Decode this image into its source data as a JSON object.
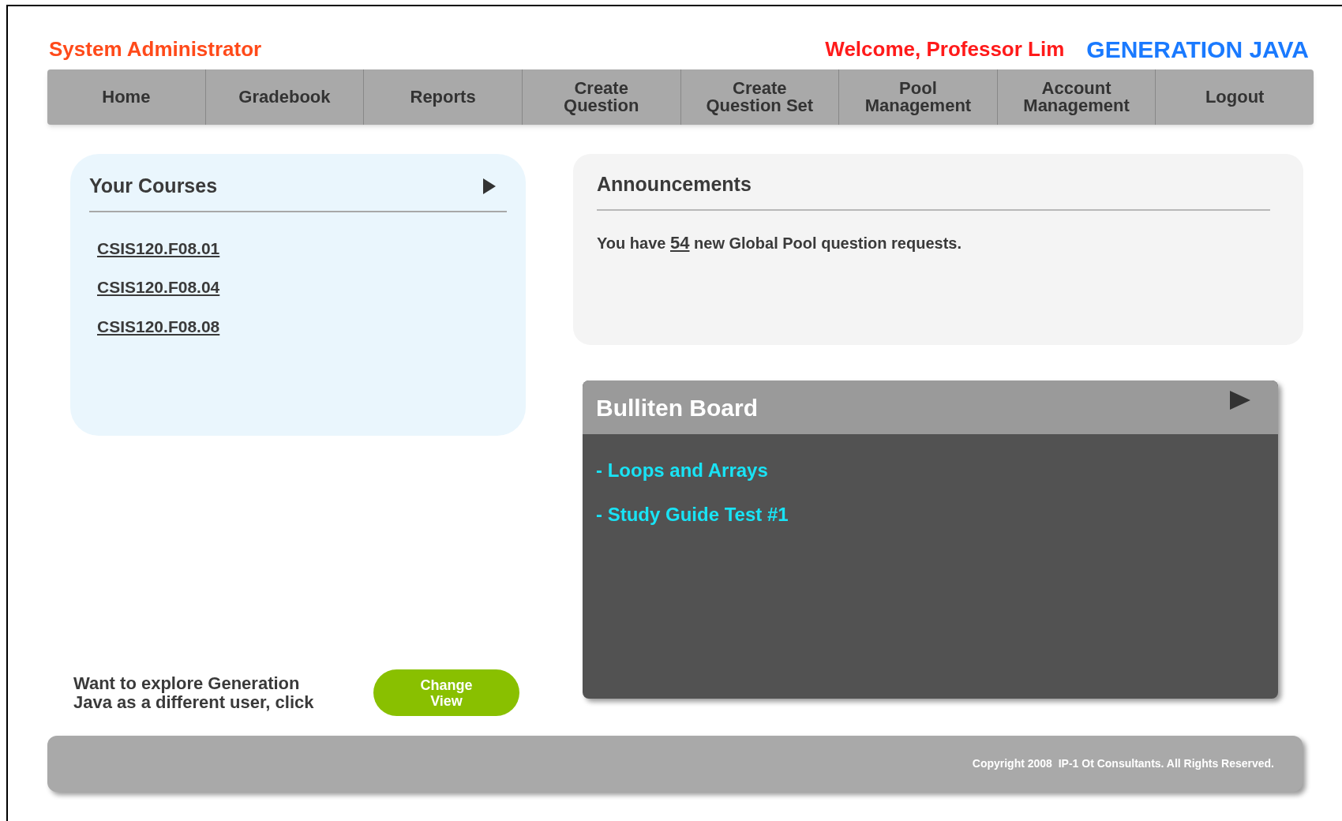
{
  "header": {
    "role": "System Administrator",
    "welcome": "Welcome, Professor Lim",
    "brand": "GENERATION JAVA"
  },
  "nav": [
    {
      "label": "Home"
    },
    {
      "label": "Gradebook"
    },
    {
      "label": "Reports"
    },
    {
      "label": "Create Question"
    },
    {
      "label": "Create Question Set"
    },
    {
      "label": "Pool Management"
    },
    {
      "label": "Account Management"
    },
    {
      "label": "Logout"
    }
  ],
  "courses": {
    "title": "Your Courses",
    "items": [
      "CSIS120.F08.01",
      "CSIS120.F08.04",
      "CSIS120.F08.08"
    ]
  },
  "announcements": {
    "title": "Announcements",
    "message": {
      "before": "You have",
      "count": "54",
      "after": "new Global Pool question requests."
    }
  },
  "bulletin": {
    "title": "Bulliten Board",
    "items": [
      "- Loops and Arrays",
      "- Study Guide Test #1"
    ]
  },
  "change_view": {
    "prompt": "Want to explore Generation Java as a different user, click",
    "button": "Change View"
  },
  "footer": {
    "copyright": "Copyright 2008  IP-1 Ot Consultants. All Rights Reserved."
  }
}
